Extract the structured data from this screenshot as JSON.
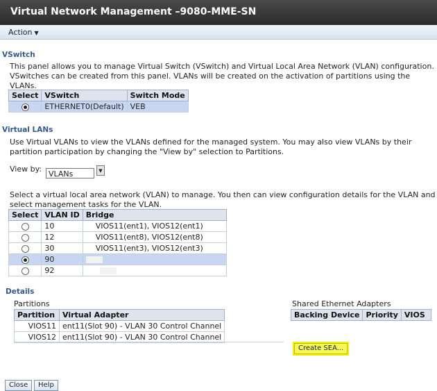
{
  "window": {
    "title": "Virtual Network Management –9080-MME-SN"
  },
  "menu": {
    "action_label": "Action"
  },
  "vswitch": {
    "heading": "VSwitch",
    "description_line1": "This panel allows you to manage Virtual Switch (VSwitch) and Virtual Local Area Network (VLAN) configuration.",
    "description_line2": "VSwitches can be created from this panel. VLANs will be created on the activation of partitions using the VLANs.",
    "columns": [
      "Select",
      "VSwitch",
      "Switch Mode"
    ],
    "rows": [
      {
        "vswitch": "ETHERNET0(Default)",
        "mode": "VEB",
        "selected": true
      }
    ]
  },
  "vlans": {
    "heading": "Virtual LANs",
    "description_line1": "Use Virtual VLANs to view the VLANs defined for the managed system. You may also view VLANs by their",
    "description_line2": "partition participation by changing the \"View by\" selection to Partitions.",
    "view_by_label": "View by:",
    "view_by_value": "VLANs",
    "select_prompt_line1": "Select a virtual local area network (VLAN) to manage. You then can view configuration details for the VLAN and",
    "select_prompt_line2": "select management tasks for the VLAN.",
    "columns": [
      "Select",
      "VLAN ID",
      "Bridge"
    ],
    "rows": [
      {
        "id": "10",
        "bridge": "VIOS11(ent1), VIOS12(ent1)",
        "selected": false
      },
      {
        "id": "12",
        "bridge": "VIOS11(ent8), VIOS12(ent8)",
        "selected": false
      },
      {
        "id": "30",
        "bridge": "VIOS11(ent3), VIOS12(ent3)",
        "selected": false
      },
      {
        "id": "90",
        "bridge": "",
        "selected": true
      },
      {
        "id": "92",
        "bridge": "",
        "selected": false
      }
    ]
  },
  "details": {
    "heading": "Details",
    "partitions_label": "Partitions",
    "partitions_columns": [
      "Partition",
      "Virtual Adapter"
    ],
    "partitions_rows": [
      {
        "partition": "VIOS11",
        "adapter": "ent11(Slot 90) - VLAN 30 Control Channel"
      },
      {
        "partition": "VIOS12",
        "adapter": "ent11(Slot 90) - VLAN 30 Control Channel"
      }
    ],
    "sea_label": "Shared Ethernet Adapters",
    "sea_columns": [
      "Backing Device",
      "Priority",
      "VIOS"
    ],
    "create_sea_label": "Create SEA..."
  },
  "footer": {
    "close_label": "Close",
    "help_label": "Help"
  },
  "colors": {
    "titlebar": "#2f2f2f",
    "section_heading": "#335a8c",
    "selected_row": "#c8d6f2",
    "highlight": "#f0f000"
  }
}
